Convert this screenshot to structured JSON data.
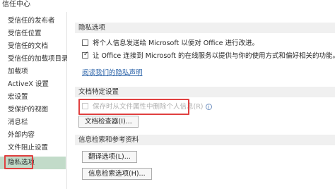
{
  "window": {
    "title": "信任中心"
  },
  "sidebar": {
    "items": [
      {
        "label": "受信任的发布者"
      },
      {
        "label": "受信任位置"
      },
      {
        "label": "受信任的文档"
      },
      {
        "label": "受信任的加载项目录"
      },
      {
        "label": "加载项"
      },
      {
        "label": "ActiveX 设置"
      },
      {
        "label": "宏设置"
      },
      {
        "label": "受保护的视图"
      },
      {
        "label": "消息栏"
      },
      {
        "label": "外部内容"
      },
      {
        "label": "文件阻止设置"
      },
      {
        "label": "隐私选项",
        "selected": true
      }
    ]
  },
  "privacy": {
    "header": "隐私选项",
    "options": [
      {
        "label": "将个人信息发送给 Microsoft 以便对 Office 进行改进。",
        "checked": false
      },
      {
        "label": "让 Office 连接到 Microsoft 的在线服务以提供与你的使用方式和偏好相关的功能。",
        "checked": true
      }
    ],
    "link": "阅读我们的隐私声明"
  },
  "document_settings": {
    "header": "文档特定设置",
    "remove_info_label": "保存时从文件属性中删除个人信息(R)",
    "remove_info_checked": false,
    "remove_info_enabled": false,
    "info_icon": "i",
    "inspector_button": "文档检查器(I)..."
  },
  "research": {
    "header": "信息检索和参考资料",
    "translation_button": "翻译选项(L)...",
    "research_button": "信息检索选项(H)..."
  },
  "colors": {
    "selected_bg": "#c2dbc9",
    "highlight": "#e04040",
    "link": "#2a62a8"
  }
}
